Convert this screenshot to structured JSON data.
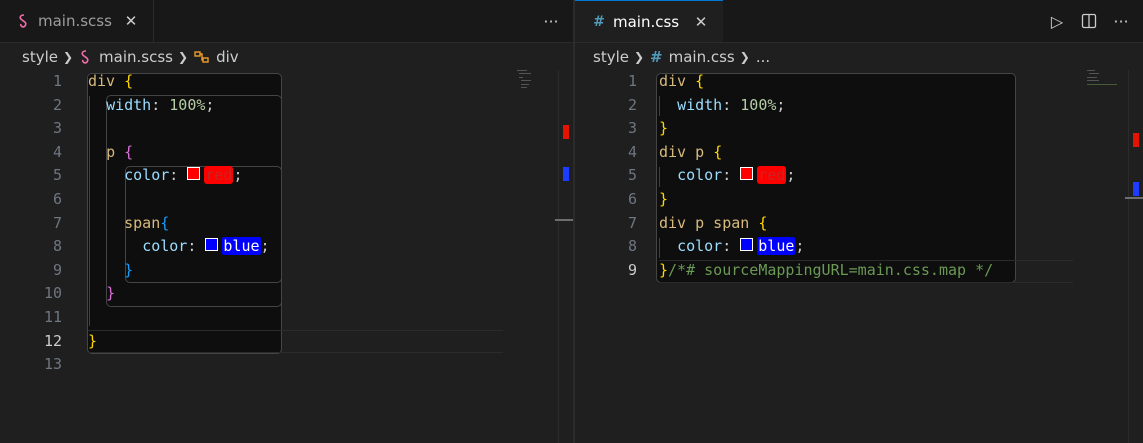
{
  "colors": {
    "accent": "#0078d4",
    "red_swatch": "#ff0000",
    "blue_swatch": "#0000ff"
  },
  "left": {
    "tab": {
      "icon": "sass-icon",
      "label": "main.scss",
      "close": "✕"
    },
    "actions": {
      "more": "···"
    },
    "breadcrumb": {
      "folder": "style",
      "file": "main.scss",
      "symbol": "div"
    },
    "line_numbers": [
      "1",
      "2",
      "3",
      "4",
      "5",
      "6",
      "7",
      "8",
      "9",
      "10",
      "11",
      "12",
      "13"
    ],
    "code": {
      "l1_sel": "div",
      "l1_brace": "{",
      "l2_prop": "width",
      "l2_val": "100%",
      "l4_sel": "p",
      "l4_brace": "{",
      "l5_prop": "color",
      "l5_val": "red",
      "l7_sel": "span",
      "l7_brace": "{",
      "l8_prop": "color",
      "l8_val": "blue",
      "l9_brace": "}",
      "l10_brace": "}",
      "l12_brace": "}"
    }
  },
  "right": {
    "tab": {
      "icon": "hash-icon",
      "label": "main.css",
      "close": "✕"
    },
    "actions": {
      "run": "▷",
      "split": "split-editor-icon",
      "more": "···"
    },
    "breadcrumb": {
      "folder": "style",
      "file": "main.css",
      "symbol": "..."
    },
    "line_numbers": [
      "1",
      "2",
      "3",
      "4",
      "5",
      "6",
      "7",
      "8",
      "9"
    ],
    "code": {
      "l1_sel": "div",
      "l1_brace": "{",
      "l2_prop": "width",
      "l2_val": "100%",
      "l3_brace": "}",
      "l4_sel": "div p",
      "l4_brace": "{",
      "l5_prop": "color",
      "l5_val": "red",
      "l6_brace": "}",
      "l7_sel": "div p span",
      "l7_brace": "{",
      "l8_prop": "color",
      "l8_val": "blue",
      "l9_brace": "}",
      "l9_comment": "/*# sourceMappingURL=main.css.map */"
    }
  }
}
